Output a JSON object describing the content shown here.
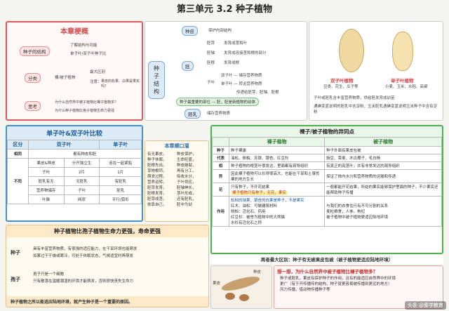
{
  "title": "第三单元 3.2 种子植物",
  "outline": {
    "header": "本章梗概",
    "item1": "种子的结构",
    "item1_sub": [
      "了解结构与功能",
      "单子叶/双子叶种子比",
      "较"
    ],
    "item2": "分类",
    "item2_sub": "裸/被子植物",
    "item2_details": [
      "最大区别",
      "注意：",
      "果皮的松果、白果是果实吗？"
    ],
    "item3": "思考",
    "item3_sub": [
      "为什么自然界中被子植物比裸子植物多？",
      "为什么种子植物比孢子植物生命力更强"
    ]
  },
  "mindmap": {
    "center": "种子结构",
    "seed_coat": "种皮",
    "seed_coat_desc": "保护内部结构",
    "embryo": "胚",
    "embryo_parts": [
      "胚芽",
      "胚轴",
      "胚根",
      "子叶"
    ],
    "embryo_desc": [
      "发育成茎和叶",
      "发育成连接茎和根的部分",
      "发育成根",
      "双子叶 — 储存营养物质",
      "单子叶 — 转运营养物质"
    ],
    "cotyledon_detail": [
      "传递给胚芽、胚轴、胚根"
    ],
    "note": "种子最重要的部位 — 胚，胚是新植物的幼体",
    "endosperm": "胚乳",
    "endosperm_desc": "储存营养物质"
  },
  "seed_images": {
    "dicot_label": "双子叶植物",
    "dicot_examples": "豆类、花生、瓜子等",
    "monocot_label": "单子叶植物",
    "monocot_examples": "小麦、玉米、水稻、高粱",
    "notes": [
      "子叶或胚乳含丰富营养物质，供给胚发育成幼苗",
      "通碘变蓝说明的胚乳中含淀粉，玉米胚乳遇碘变蓝说明玉米种子中含有淀粉"
    ]
  },
  "compare_table": {
    "header": "单子叶&双子叶比较",
    "cols": [
      "区分",
      "双子叶",
      "单子叶"
    ],
    "rows": [
      [
        "相同",
        "都有种皮和胚",
        ""
      ],
      [
        "",
        "果皮&种皮",
        "分开独立生",
        "连在一起紧贴"
      ],
      [
        "不同",
        "子叶",
        "2片",
        "1片"
      ],
      [
        "",
        "胚乳有无",
        "无胚乳",
        "有胚乳"
      ],
      [
        "",
        "营养物储存",
        "子叶",
        "胚乳"
      ],
      [
        "",
        "叶脉",
        "网状",
        "平行/弧形"
      ]
    ]
  },
  "tip_box": {
    "header": "本章顺口溜",
    "lines": [
      "有无果皮，",
      "种子休眠，",
      "胚根先出，",
      "芽物根钙，",
      "萌发过程，",
      "营养运转，",
      "胚芽发育，",
      "胚根发育，",
      "胚芽成茎，",
      "依靠自己，"
    ],
    "lines2": [
      "种皮保护，",
      "生命旺盛，",
      "种皮破裂，",
      "再有分工，",
      "吸收水分，",
      "子叶供应，",
      "胚轴伸长，",
      "茎叶形成，",
      "还有胚乳，",
      "胚中为幼"
    ]
  },
  "life_section": {
    "header": "种子植物比孢子植物生命力更强，寿命更强",
    "seed_label": "种子",
    "seed_points": [
      "具有丰富营养物质，有很强的适应能力，在干旱环境也能萌发",
      "如果过于干燥或寒冷，可处于休眠状态，气候适宜时再萌发"
    ],
    "spore_label": "孢子",
    "spore_points": [
      "孢子只是一个细胞",
      "只有散落在温暖潮湿的环境才能萌发，否则很快丧失生命力"
    ],
    "summary": "种子植物之所以能适应陆地环境，就产生种子是一个重要的原因。"
  },
  "diff_table": {
    "header": "裸子/被子植物的异同点",
    "cols": [
      "",
      "裸子植物",
      "被子植物"
    ],
    "rows": [
      [
        "种子",
        "种子裸露",
        "种子外面有果皮包被"
      ],
      [
        "代表",
        "油松、侧柏、苏铁、银杏、红豆杉",
        "豌豆、菜麦、木瓜椰子、毛白杨"
      ],
      [
        "相",
        "种子植物的根茎叶很发达，里面都有疏导组织",
        "有真正的亮茎叶，并有非常发达的疏导组织"
      ],
      [
        "异",
        "因此裸子植物可以长得很高大，也能在干旱和土壤贫瘠的地方生长",
        "保证了体内水分和营养物质的运输和传递"
      ],
      [
        "花",
        "只有种子，不开花结果",
        "一般都能开花结果，所结的果实能够保护里面的种子，不少果实还能帮助种子传播"
      ],
      [
        "作用",
        "松柏的球果、银杏的白果是种子，不是果实",
        "与我们的衣食住行有不可分割的关系"
      ]
    ],
    "highlight": "裸子植物只有种子，无花，果实",
    "uses": [
      "红木、油松：可做建筑材料",
      "侧柏：活化石、药用",
      "红豆杉：被誉为植物中的大熊猫",
      "水杉有活化石之称"
    ],
    "uses2": [
      "麦粒粮食，人参、枸杞",
      "被子植物中被子植物更适应陆地环境"
    ]
  },
  "bottom_band": "再者最大区别：种子有无被果皮包被（被子植物更适应陆地环境）",
  "fruit_labels": [
    "果皮",
    "种皮"
  ],
  "thinking": {
    "label": "想一想，为什么自然界中被子植物比裸子植物多？",
    "lines": [
      "种子或胚乳，果皮有保护种子的作用，且有的能适应自然界中的环境",
      "更广（有于开传播传的结构，种子就更容易被传播到更远的地方）",
      "风力传播，借动物传播种子等"
    ]
  },
  "watermark": "头条 @秦学教育"
}
